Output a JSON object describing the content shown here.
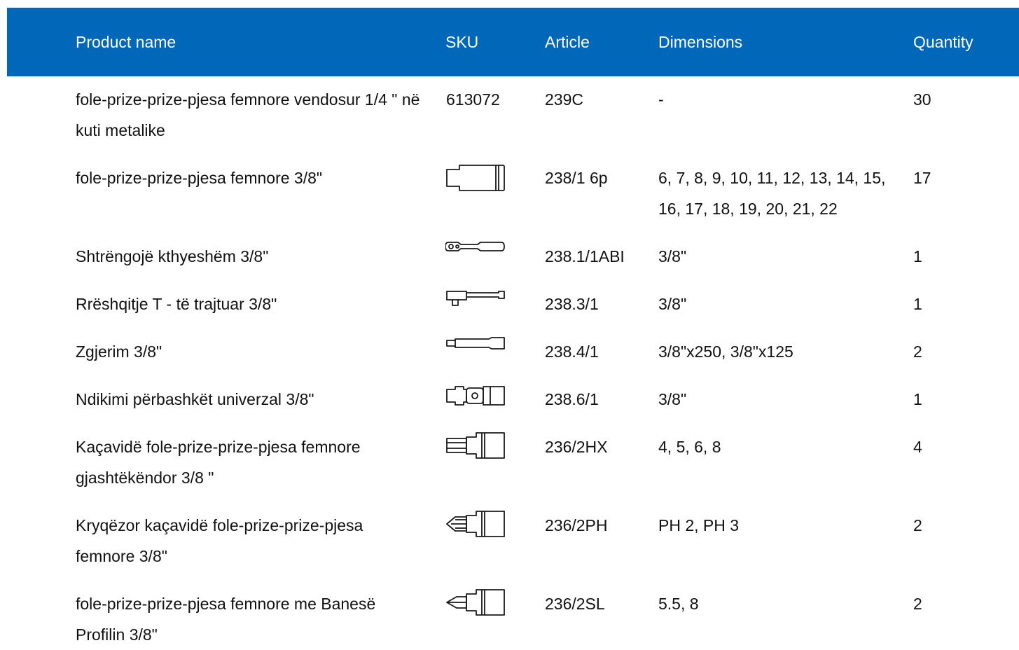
{
  "table": {
    "header_color": "#0067b9",
    "headers": {
      "name": "Product name",
      "sku": "SKU",
      "article": "Article",
      "dimensions": "Dimensions",
      "quantity": "Quantity"
    },
    "rows": [
      {
        "name": "fole-prize-prize-pjesa femnore vendosur 1/4 \" në kuti metalike",
        "sku": "613072",
        "article": "239C",
        "dimensions": "-",
        "quantity": "30"
      },
      {
        "name": "fole-prize-prize-pjesa femnore 3/8\"",
        "sku_icon": "socket-icon",
        "article": "238/1 6p",
        "dimensions": "6, 7, 8, 9, 10, 11, 12, 13, 14, 15, 16, 17, 18, 19, 20, 21, 22",
        "quantity": "17"
      },
      {
        "name": "Shtrëngojë kthyeshëm 3/8\"",
        "sku_icon": "ratchet-icon",
        "article": "238.1/1ABI",
        "dimensions": "3/8\"",
        "quantity": "1"
      },
      {
        "name": "Rrëshqitje T - të trajtuar 3/8\"",
        "sku_icon": "t-handle-icon",
        "article": "238.3/1",
        "dimensions": "3/8\"",
        "quantity": "1"
      },
      {
        "name": "Zgjerim 3/8\"",
        "sku_icon": "extension-bar-icon",
        "article": "238.4/1",
        "dimensions": "3/8\"x250, 3/8\"x125",
        "quantity": "2"
      },
      {
        "name": "Ndikimi përbashkët univerzal 3/8\"",
        "sku_icon": "universal-joint-icon",
        "article": "238.6/1",
        "dimensions": "3/8\"",
        "quantity": "1"
      },
      {
        "name": "Kaçavidë fole-prize-prize-pjesa femnore gjashtëkëndor 3/8 \"",
        "sku_icon": "hex-bit-socket-icon",
        "article": "236/2HX",
        "dimensions": "4, 5, 6, 8",
        "quantity": "4"
      },
      {
        "name": "Kryqëzor kaçavidë fole-prize-prize-pjesa femnore 3/8\"",
        "sku_icon": "phillips-bit-socket-icon",
        "article": "236/2PH",
        "dimensions": "PH 2, PH 3",
        "quantity": "2"
      },
      {
        "name": "fole-prize-prize-pjesa femnore me Banesë Profilin 3/8\"",
        "sku_icon": "slotted-bit-socket-icon",
        "article": "236/2SL",
        "dimensions": "5.5, 8",
        "quantity": "2"
      }
    ]
  }
}
